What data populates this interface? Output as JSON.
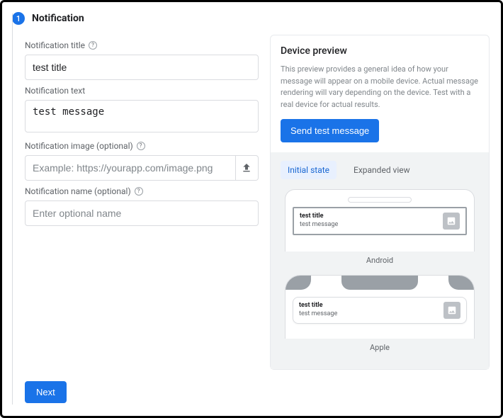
{
  "step": {
    "number": "1",
    "title": "Notification"
  },
  "form": {
    "title_label": "Notification title",
    "title_value": "test title",
    "text_label": "Notification text",
    "text_value": "test message",
    "image_label": "Notification image (optional)",
    "image_placeholder": "Example: https://yourapp.com/image.png",
    "name_label": "Notification name (optional)",
    "name_placeholder": "Enter optional name"
  },
  "footer": {
    "next_label": "Next"
  },
  "preview": {
    "heading": "Device preview",
    "description": "This preview provides a general idea of how your message will appear on a mobile device. Actual message rendering will vary depending on the device. Test with a real device for actual results.",
    "send_label": "Send test message",
    "tabs": {
      "initial": "Initial state",
      "expanded": "Expanded view"
    },
    "android_label": "Android",
    "apple_label": "Apple",
    "notif": {
      "title": "test title",
      "message": "test message"
    }
  }
}
